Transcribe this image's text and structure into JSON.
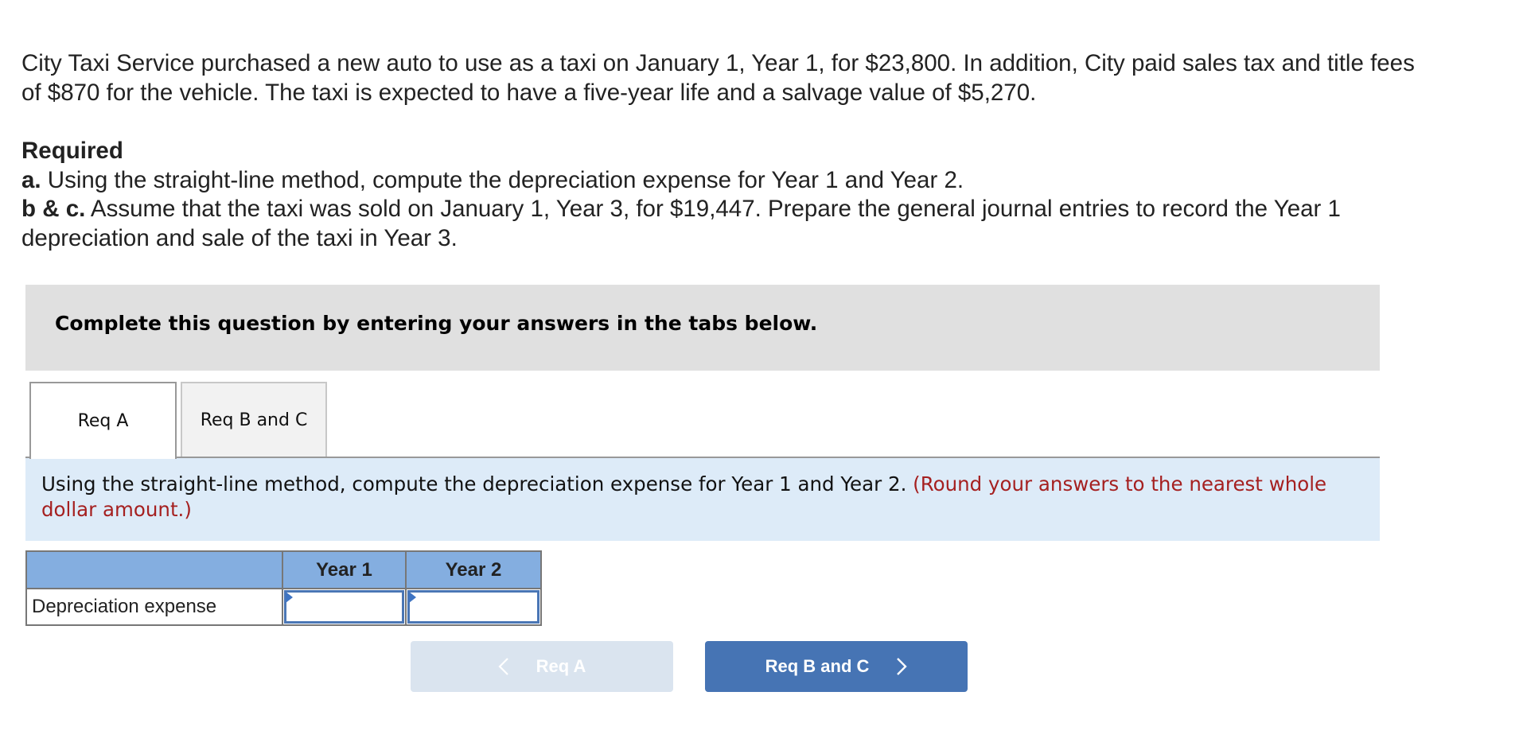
{
  "problem": {
    "intro_lines": [
      "City Taxi Service purchased a new auto to use as a taxi on January 1, Year 1, for $23,800. In addition, City paid sales tax and title fees",
      "of $870 for the vehicle. The taxi is expected to have a five-year life and a salvage value of $5,270."
    ],
    "required_heading": "Required",
    "req_a_prefix": "a.",
    "req_a_text": " Using the straight-line method, compute the depreciation expense for Year 1 and Year 2.",
    "req_bc_prefix": "b & c.",
    "req_bc_text_line1": " Assume that the taxi was sold on January 1, Year 3, for $19,447. Prepare the general journal entries to record the Year 1",
    "req_bc_text_line2": "depreciation and sale of the taxi in Year 3."
  },
  "banner": {
    "text": "Complete this question by entering your answers in the tabs below."
  },
  "tabs": [
    {
      "label": "Req A",
      "active": true
    },
    {
      "label": "Req B and C",
      "active": false
    }
  ],
  "panel": {
    "instruction": "Using the straight-line method, compute the depreciation expense for Year 1 and Year 2. ",
    "note": "(Round your answers to the nearest whole dollar amount.)"
  },
  "table": {
    "headers": [
      "",
      "Year 1",
      "Year 2"
    ],
    "rows": [
      {
        "label": "Depreciation expense",
        "year1": "",
        "year2": ""
      }
    ]
  },
  "nav": {
    "prev_label": "Req A",
    "prev_enabled": false,
    "next_label": "Req B and C",
    "next_enabled": true
  },
  "colors": {
    "banner_bg": "#e0e0e0",
    "panel_bg": "#ddebf8",
    "note_red": "#a52020",
    "table_header_bg": "#84aee0",
    "input_border": "#4a76b5",
    "next_button": "#4674b4",
    "prev_button_disabled": "#dae4ef"
  }
}
